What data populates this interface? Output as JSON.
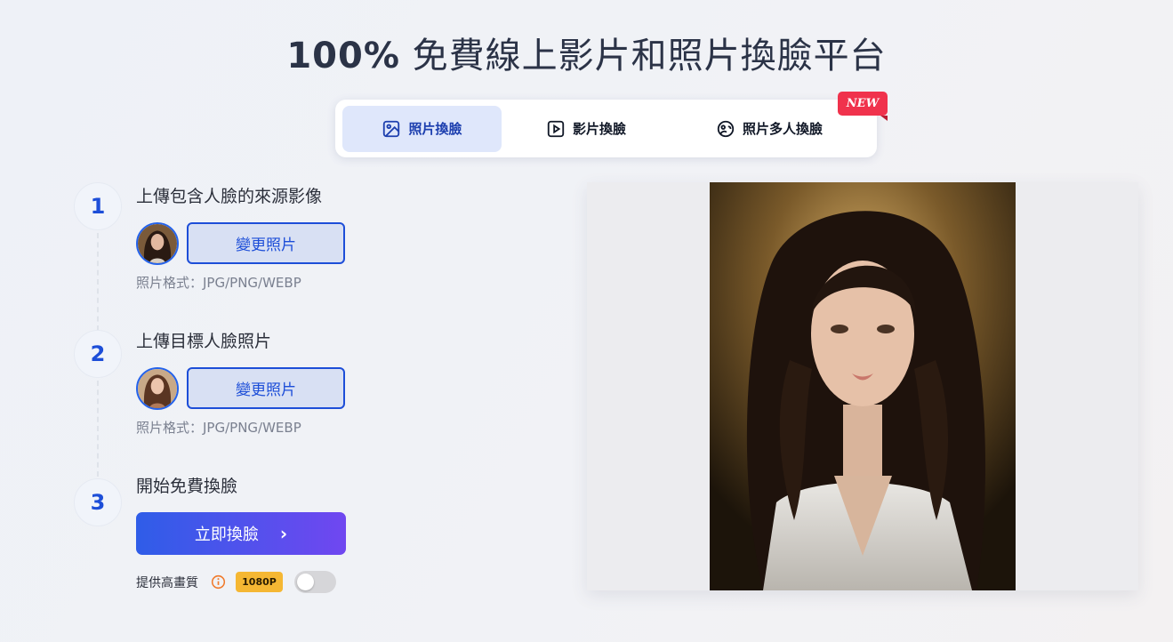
{
  "title": {
    "bold": "100%",
    "rest": " 免費線上影片和照片換臉平台"
  },
  "tabs": [
    {
      "label": "照片換臉",
      "icon": "image-icon",
      "active": true
    },
    {
      "label": "影片換臉",
      "icon": "play-icon",
      "active": false
    },
    {
      "label": "照片多人換臉",
      "icon": "multi-face-icon",
      "active": false,
      "badge": "NEW"
    }
  ],
  "steps": [
    {
      "number": "1",
      "title": "上傳包含人臉的來源影像",
      "button": "變更照片",
      "format": "照片格式：JPG/PNG/WEBP"
    },
    {
      "number": "2",
      "title": "上傳目標人臉照片",
      "button": "變更照片",
      "format": "照片格式：JPG/PNG/WEBP"
    },
    {
      "number": "3",
      "title": "開始免費換臉",
      "button": "立即換臉"
    }
  ],
  "hq": {
    "label": "提供高畫質",
    "badge": "1080P",
    "toggle_on": false
  },
  "colors": {
    "accent": "#1d4ed8",
    "gradient_start": "#2f5de8",
    "gradient_end": "#7047f0",
    "new_badge": "#f0324c",
    "hd_badge": "#f5b733"
  }
}
